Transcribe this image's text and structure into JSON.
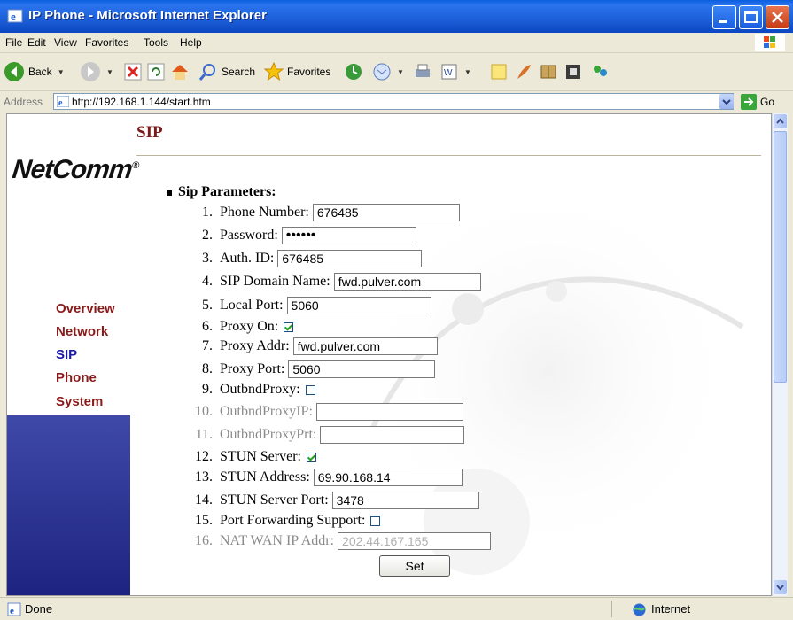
{
  "window": {
    "title": "IP Phone - Microsoft Internet Explorer"
  },
  "menu": {
    "items": [
      "File",
      "Edit",
      "View",
      "Favorites",
      "Tools",
      "Help"
    ]
  },
  "toolbar": {
    "back_label": "Back",
    "search_label": "Search",
    "favorites_label": "Favorites"
  },
  "address": {
    "label": "Address",
    "url": "http://192.168.1.144/start.htm",
    "go_label": "Go"
  },
  "sidebar": {
    "logo": "NetComm",
    "logo_mark": "®",
    "items": [
      {
        "label": "Overview"
      },
      {
        "label": "Network"
      },
      {
        "label": "SIP",
        "active": true
      },
      {
        "label": "Phone"
      },
      {
        "label": "System"
      }
    ]
  },
  "page": {
    "title": "SIP",
    "section": "Sip Parameters:",
    "fields": [
      {
        "num": "1.",
        "label": "Phone Number:",
        "type": "text",
        "value": "676485"
      },
      {
        "num": "2.",
        "label": "Password:",
        "type": "password",
        "value": "••••••"
      },
      {
        "num": "3.",
        "label": "Auth. ID:",
        "type": "text",
        "value": "676485"
      },
      {
        "num": "4.",
        "label": "SIP Domain Name:",
        "type": "text",
        "value": "fwd.pulver.com"
      },
      {
        "num": "5.",
        "label": "Local Port:",
        "type": "text",
        "value": "5060"
      },
      {
        "num": "6.",
        "label": "Proxy On:",
        "type": "checkbox",
        "checked": true
      },
      {
        "num": "7.",
        "label": "Proxy Addr:",
        "type": "text",
        "value": "fwd.pulver.com"
      },
      {
        "num": "8.",
        "label": "Proxy Port:",
        "type": "text",
        "value": "5060"
      },
      {
        "num": "9.",
        "label": "OutbndProxy:",
        "type": "checkbox",
        "checked": false
      },
      {
        "num": "10.",
        "label": "OutbndProxyIP:",
        "type": "text",
        "value": "",
        "disabled": true
      },
      {
        "num": "11.",
        "label": "OutbndProxyPrt:",
        "type": "text",
        "value": "",
        "disabled": true
      },
      {
        "num": "12.",
        "label": "STUN Server:",
        "type": "checkbox",
        "checked": true
      },
      {
        "num": "13.",
        "label": "STUN Address:",
        "type": "text",
        "value": "69.90.168.14"
      },
      {
        "num": "14.",
        "label": "STUN Server Port:",
        "type": "text",
        "value": "3478"
      },
      {
        "num": "15.",
        "label": "Port Forwarding Support:",
        "type": "checkbox",
        "checked": false
      },
      {
        "num": "16.",
        "label": "NAT WAN IP Addr:",
        "type": "text",
        "value": "202.44.167.165",
        "disabled": true
      }
    ],
    "set_label": "Set"
  },
  "status": {
    "text": "Done",
    "zone": "Internet"
  }
}
